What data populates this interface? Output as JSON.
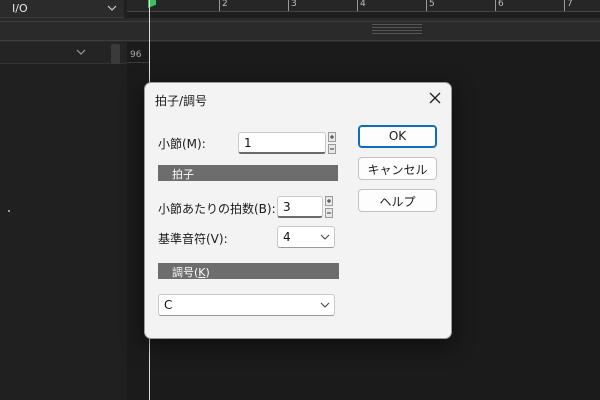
{
  "background": {
    "io_label": "I/O",
    "ruler_numbers": [
      "2",
      "3",
      "4",
      "5",
      "6",
      "7"
    ],
    "lane_position": "96",
    "playhead_color": "#3fbf60"
  },
  "dialog": {
    "title": "拍子/調号",
    "close_icon": "close-icon",
    "measure": {
      "label": "小節(M):",
      "value": "1"
    },
    "meter_section": "拍子",
    "beats": {
      "label": "小節あたりの拍数(B):",
      "value": "3"
    },
    "beat_unit": {
      "label": "基準音符(V):",
      "value": "4"
    },
    "key_section": {
      "label": "調号",
      "accel_open": "(",
      "accel_key": "K",
      "accel_close": ")"
    },
    "key_value": "C",
    "buttons": {
      "ok": "OK",
      "cancel": "キャンセル",
      "help": "ヘルプ"
    },
    "accent_color": "#0f6cbd"
  }
}
